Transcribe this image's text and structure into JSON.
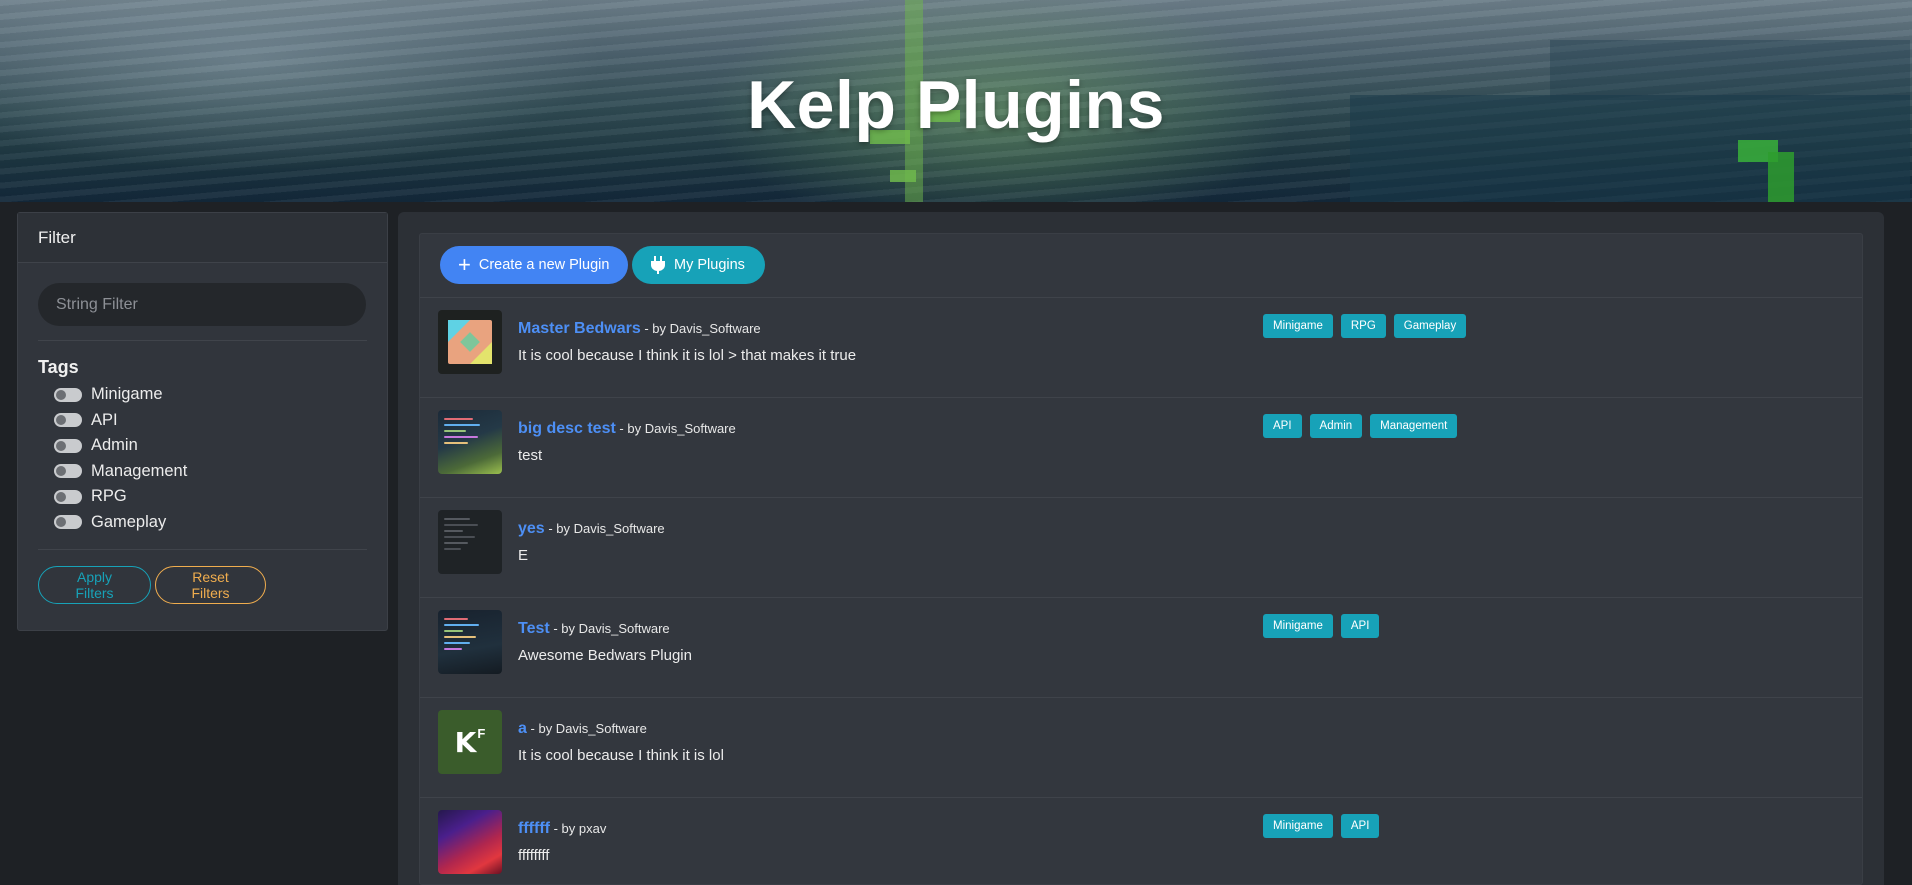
{
  "header": {
    "title": "Kelp Plugins"
  },
  "filter": {
    "title": "Filter",
    "search_placeholder": "String Filter",
    "tags_title": "Tags",
    "tags": [
      "Minigame",
      "API",
      "Admin",
      "Management",
      "RPG",
      "Gameplay"
    ],
    "apply_label": "Apply Filters",
    "reset_label": "Reset Filters"
  },
  "toolbar": {
    "create_label": "Create a new Plugin",
    "my_plugins_label": "My Plugins"
  },
  "plugins": [
    {
      "name": "Master Bedwars",
      "by": " - by Davis_Software",
      "description": "It is cool because I think it is lol > that makes it true",
      "tags": [
        "Minigame",
        "RPG",
        "Gameplay"
      ]
    },
    {
      "name": "big desc test",
      "by": " - by Davis_Software",
      "description": "test",
      "tags": [
        "API",
        "Admin",
        "Management"
      ]
    },
    {
      "name": "yes",
      "by": " - by Davis_Software",
      "description": "E",
      "tags": []
    },
    {
      "name": "Test",
      "by": " - by Davis_Software",
      "description": "Awesome Bedwars Plugin",
      "tags": [
        "Minigame",
        "API"
      ]
    },
    {
      "name": "a",
      "by": " - by Davis_Software",
      "description": "It is cool because I think it is lol",
      "tags": []
    },
    {
      "name": "ffffff",
      "by": " - by pxav",
      "description": "ffffffff",
      "tags": [
        "Minigame",
        "API"
      ]
    }
  ],
  "thumb_text": {
    "kf_main": "K",
    "kf_sup": "F"
  },
  "colors": {
    "accent_blue": "#4284f3",
    "info_teal": "#17a2b8",
    "warning_orange": "#f0ad4e",
    "plugin_link": "#4d8ff5"
  }
}
